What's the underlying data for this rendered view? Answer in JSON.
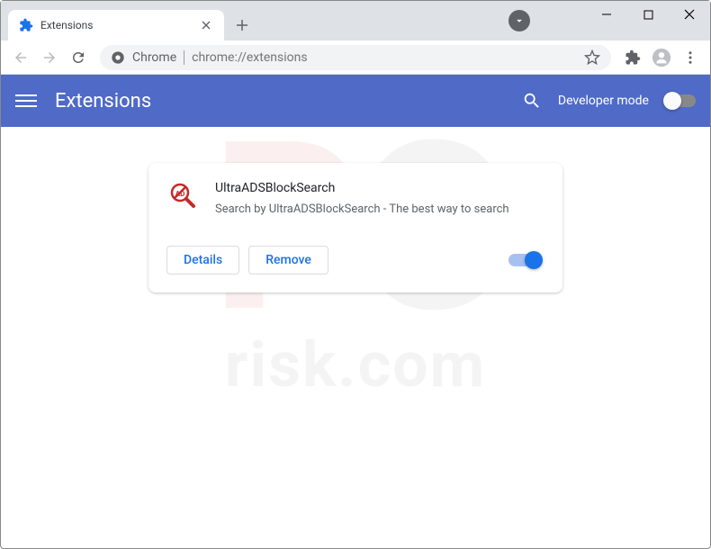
{
  "window": {
    "tab_title": "Extensions"
  },
  "omnibox": {
    "prefix": "Chrome",
    "url": "chrome://extensions"
  },
  "header": {
    "title": "Extensions",
    "dev_mode_label": "Developer mode"
  },
  "extension": {
    "name": "UltraADSBlockSearch",
    "description": "Search by UltraADSBlockSearch - The best way to search",
    "details_label": "Details",
    "remove_label": "Remove"
  },
  "watermark": {
    "p": "P",
    "c": "C",
    "text": "risk.com"
  }
}
